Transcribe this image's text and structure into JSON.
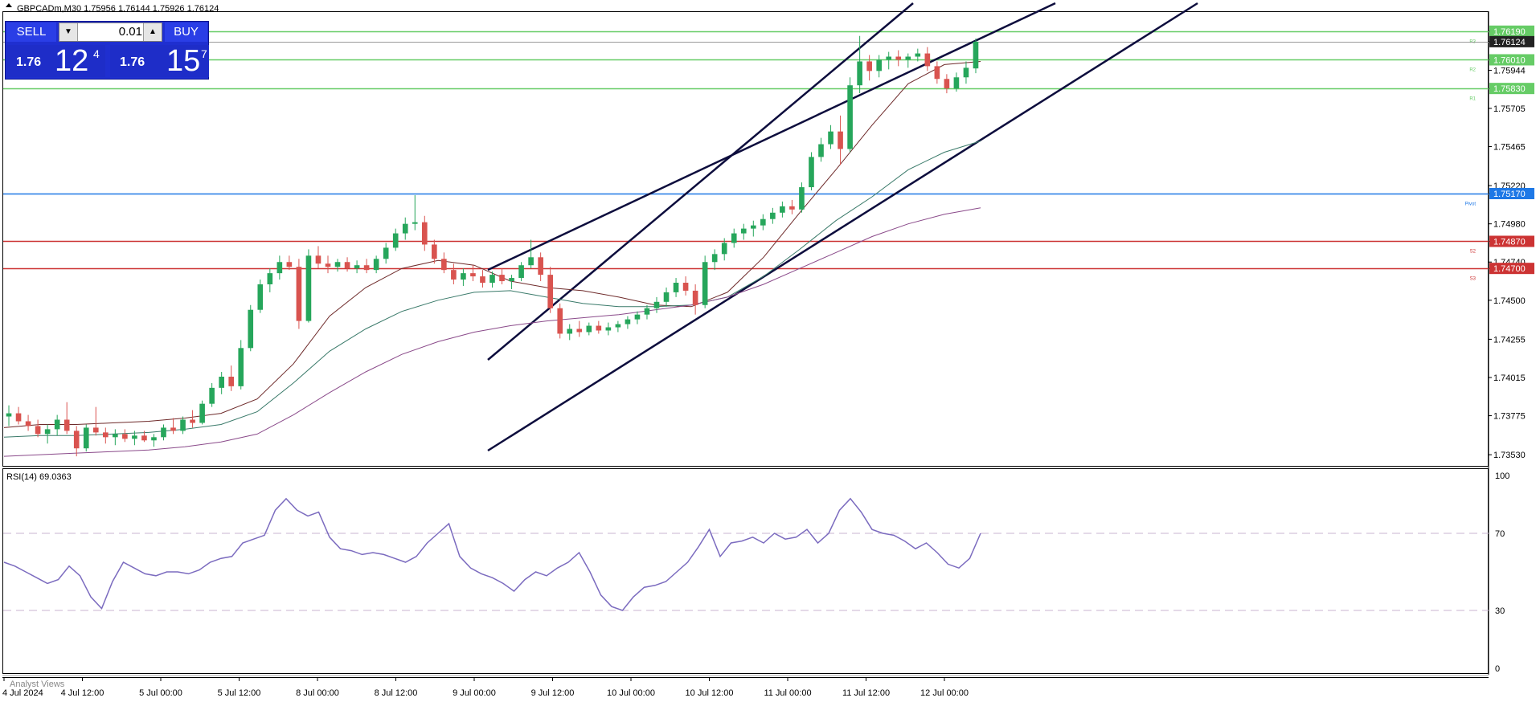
{
  "header": {
    "symbol_ohlc": "GBPCADm,M30  1.75956 1.76144 1.75926 1.76124",
    "rsi_label": "RSI(14) 69.0363",
    "analyst_views": "Analyst Views"
  },
  "trade_panel": {
    "sell_label": "SELL",
    "buy_label": "BUY",
    "lot": "0.01",
    "sell_prefix": "1.76",
    "sell_big": "12",
    "sell_sup": "4",
    "buy_prefix": "1.76",
    "buy_big": "15",
    "buy_sup": "7"
  },
  "chart_data": {
    "type": "candlestick",
    "symbol": "GBPCADm",
    "timeframe": "M30",
    "price_ticks": [
      1.7619,
      1.76124,
      1.7601,
      1.75944,
      1.7583,
      1.75705,
      1.75465,
      1.7522,
      1.7517,
      1.7498,
      1.7487,
      1.7474,
      1.747,
      1.745,
      1.74255,
      1.74015,
      1.73775,
      1.7353
    ],
    "price_tick_labels": [
      "1.76190",
      "1.76124",
      "1.76010",
      "1.75944",
      "1.75830",
      "1.75705",
      "1.75465",
      "1.75220",
      "1.75170",
      "1.74980",
      "1.74870",
      "1.74740",
      "1.74700",
      "1.74500",
      "1.74255",
      "1.74015",
      "1.73775",
      "1.73530"
    ],
    "ylim": [
      1.7346,
      1.7631
    ],
    "x_labels": [
      "4 Jul 2024",
      "4 Jul 12:00",
      "5 Jul 00:00",
      "5 Jul 12:00",
      "8 Jul 00:00",
      "8 Jul 12:00",
      "9 Jul 00:00",
      "9 Jul 12:00",
      "10 Jul 00:00",
      "10 Jul 12:00",
      "11 Jul 00:00",
      "11 Jul 12:00",
      "12 Jul 00:00"
    ],
    "current_price": 1.76124,
    "levels": [
      {
        "price": 1.7619,
        "label": "1.76190",
        "tag": "R3",
        "color": "#66cc66"
      },
      {
        "price": 1.7601,
        "label": "1.76010",
        "tag": "R2",
        "color": "#66cc66"
      },
      {
        "price": 1.7583,
        "label": "1.75830",
        "tag": "R1",
        "color": "#66cc66"
      },
      {
        "price": 1.7517,
        "label": "1.75170",
        "tag": "Pivot",
        "color": "#1e78e6"
      },
      {
        "price": 1.7487,
        "label": "1.74870",
        "tag": "S2",
        "color": "#cc3333"
      },
      {
        "price": 1.747,
        "label": "1.74700",
        "tag": "S3",
        "color": "#cc3333"
      }
    ],
    "candles": [
      {
        "o": 1.7377,
        "h": 1.7384,
        "l": 1.7371,
        "c": 1.7379
      },
      {
        "o": 1.7379,
        "h": 1.7383,
        "l": 1.7372,
        "c": 1.7374
      },
      {
        "o": 1.7374,
        "h": 1.7378,
        "l": 1.7368,
        "c": 1.7371
      },
      {
        "o": 1.7371,
        "h": 1.7375,
        "l": 1.7364,
        "c": 1.7366
      },
      {
        "o": 1.7366,
        "h": 1.7372,
        "l": 1.736,
        "c": 1.7369
      },
      {
        "o": 1.7369,
        "h": 1.7378,
        "l": 1.7365,
        "c": 1.7375
      },
      {
        "o": 1.7375,
        "h": 1.7386,
        "l": 1.7366,
        "c": 1.7368
      },
      {
        "o": 1.7368,
        "h": 1.7371,
        "l": 1.7352,
        "c": 1.7357
      },
      {
        "o": 1.7357,
        "h": 1.7372,
        "l": 1.7355,
        "c": 1.737
      },
      {
        "o": 1.737,
        "h": 1.7383,
        "l": 1.7365,
        "c": 1.7367
      },
      {
        "o": 1.7367,
        "h": 1.737,
        "l": 1.736,
        "c": 1.7364
      },
      {
        "o": 1.7364,
        "h": 1.7369,
        "l": 1.7359,
        "c": 1.7366
      },
      {
        "o": 1.7366,
        "h": 1.7369,
        "l": 1.7361,
        "c": 1.7363
      },
      {
        "o": 1.7363,
        "h": 1.7368,
        "l": 1.7359,
        "c": 1.7365
      },
      {
        "o": 1.7365,
        "h": 1.7368,
        "l": 1.7361,
        "c": 1.7362
      },
      {
        "o": 1.7362,
        "h": 1.7366,
        "l": 1.7358,
        "c": 1.7364
      },
      {
        "o": 1.7364,
        "h": 1.7372,
        "l": 1.7362,
        "c": 1.737
      },
      {
        "o": 1.737,
        "h": 1.7376,
        "l": 1.7366,
        "c": 1.7368
      },
      {
        "o": 1.7368,
        "h": 1.7377,
        "l": 1.7366,
        "c": 1.7375
      },
      {
        "o": 1.7375,
        "h": 1.7381,
        "l": 1.737,
        "c": 1.7373
      },
      {
        "o": 1.7373,
        "h": 1.7387,
        "l": 1.7372,
        "c": 1.7385
      },
      {
        "o": 1.7385,
        "h": 1.7398,
        "l": 1.7383,
        "c": 1.7395
      },
      {
        "o": 1.7395,
        "h": 1.7405,
        "l": 1.7391,
        "c": 1.7402
      },
      {
        "o": 1.7402,
        "h": 1.7409,
        "l": 1.7393,
        "c": 1.7396
      },
      {
        "o": 1.7396,
        "h": 1.7425,
        "l": 1.7394,
        "c": 1.742
      },
      {
        "o": 1.742,
        "h": 1.7447,
        "l": 1.7418,
        "c": 1.7444
      },
      {
        "o": 1.7444,
        "h": 1.7463,
        "l": 1.7442,
        "c": 1.746
      },
      {
        "o": 1.746,
        "h": 1.747,
        "l": 1.7455,
        "c": 1.7467
      },
      {
        "o": 1.7467,
        "h": 1.7478,
        "l": 1.7463,
        "c": 1.7474
      },
      {
        "o": 1.7474,
        "h": 1.7478,
        "l": 1.7469,
        "c": 1.7471
      },
      {
        "o": 1.7471,
        "h": 1.7476,
        "l": 1.7432,
        "c": 1.7437
      },
      {
        "o": 1.7437,
        "h": 1.7482,
        "l": 1.7436,
        "c": 1.7478
      },
      {
        "o": 1.7478,
        "h": 1.7484,
        "l": 1.747,
        "c": 1.7473
      },
      {
        "o": 1.7473,
        "h": 1.7478,
        "l": 1.7467,
        "c": 1.7471
      },
      {
        "o": 1.7471,
        "h": 1.7476,
        "l": 1.7468,
        "c": 1.7474
      },
      {
        "o": 1.7474,
        "h": 1.7477,
        "l": 1.7468,
        "c": 1.747
      },
      {
        "o": 1.747,
        "h": 1.7475,
        "l": 1.7467,
        "c": 1.7472
      },
      {
        "o": 1.7472,
        "h": 1.7476,
        "l": 1.7467,
        "c": 1.7469
      },
      {
        "o": 1.7469,
        "h": 1.7478,
        "l": 1.7467,
        "c": 1.7476
      },
      {
        "o": 1.7476,
        "h": 1.7486,
        "l": 1.7473,
        "c": 1.7483
      },
      {
        "o": 1.7483,
        "h": 1.7495,
        "l": 1.7481,
        "c": 1.7492
      },
      {
        "o": 1.7492,
        "h": 1.7502,
        "l": 1.7488,
        "c": 1.7498
      },
      {
        "o": 1.7498,
        "h": 1.7516,
        "l": 1.7494,
        "c": 1.7499
      },
      {
        "o": 1.7499,
        "h": 1.7503,
        "l": 1.7481,
        "c": 1.7485
      },
      {
        "o": 1.7485,
        "h": 1.7488,
        "l": 1.7473,
        "c": 1.7476
      },
      {
        "o": 1.7476,
        "h": 1.748,
        "l": 1.7467,
        "c": 1.7469
      },
      {
        "o": 1.7469,
        "h": 1.7473,
        "l": 1.746,
        "c": 1.7463
      },
      {
        "o": 1.7463,
        "h": 1.747,
        "l": 1.7459,
        "c": 1.7467
      },
      {
        "o": 1.7467,
        "h": 1.7472,
        "l": 1.7462,
        "c": 1.7465
      },
      {
        "o": 1.7465,
        "h": 1.7469,
        "l": 1.7458,
        "c": 1.7461
      },
      {
        "o": 1.7461,
        "h": 1.7468,
        "l": 1.7458,
        "c": 1.7466
      },
      {
        "o": 1.7466,
        "h": 1.747,
        "l": 1.746,
        "c": 1.7462
      },
      {
        "o": 1.7462,
        "h": 1.7466,
        "l": 1.7457,
        "c": 1.7464
      },
      {
        "o": 1.7464,
        "h": 1.7474,
        "l": 1.7462,
        "c": 1.7472
      },
      {
        "o": 1.7472,
        "h": 1.7488,
        "l": 1.747,
        "c": 1.7477
      },
      {
        "o": 1.7477,
        "h": 1.748,
        "l": 1.7462,
        "c": 1.7466
      },
      {
        "o": 1.7466,
        "h": 1.7471,
        "l": 1.7442,
        "c": 1.7445
      },
      {
        "o": 1.7445,
        "h": 1.7448,
        "l": 1.7426,
        "c": 1.7429
      },
      {
        "o": 1.7429,
        "h": 1.7435,
        "l": 1.7425,
        "c": 1.7432
      },
      {
        "o": 1.7432,
        "h": 1.7437,
        "l": 1.7427,
        "c": 1.743
      },
      {
        "o": 1.743,
        "h": 1.7436,
        "l": 1.7428,
        "c": 1.7434
      },
      {
        "o": 1.7434,
        "h": 1.7437,
        "l": 1.7429,
        "c": 1.7431
      },
      {
        "o": 1.7431,
        "h": 1.7436,
        "l": 1.7428,
        "c": 1.7433
      },
      {
        "o": 1.7433,
        "h": 1.7437,
        "l": 1.743,
        "c": 1.7435
      },
      {
        "o": 1.7435,
        "h": 1.744,
        "l": 1.7432,
        "c": 1.7438
      },
      {
        "o": 1.7438,
        "h": 1.7443,
        "l": 1.7435,
        "c": 1.7441
      },
      {
        "o": 1.7441,
        "h": 1.7447,
        "l": 1.7438,
        "c": 1.7445
      },
      {
        "o": 1.7445,
        "h": 1.7452,
        "l": 1.7442,
        "c": 1.7449
      },
      {
        "o": 1.7449,
        "h": 1.7458,
        "l": 1.7446,
        "c": 1.7455
      },
      {
        "o": 1.7455,
        "h": 1.7464,
        "l": 1.7452,
        "c": 1.7461
      },
      {
        "o": 1.7461,
        "h": 1.7465,
        "l": 1.7453,
        "c": 1.7456
      },
      {
        "o": 1.7456,
        "h": 1.746,
        "l": 1.7441,
        "c": 1.7447
      },
      {
        "o": 1.7447,
        "h": 1.7478,
        "l": 1.7445,
        "c": 1.7474
      },
      {
        "o": 1.7474,
        "h": 1.7482,
        "l": 1.7469,
        "c": 1.7479
      },
      {
        "o": 1.7479,
        "h": 1.7489,
        "l": 1.7475,
        "c": 1.7486
      },
      {
        "o": 1.7486,
        "h": 1.7495,
        "l": 1.7483,
        "c": 1.7492
      },
      {
        "o": 1.7492,
        "h": 1.7498,
        "l": 1.7488,
        "c": 1.7495
      },
      {
        "o": 1.7495,
        "h": 1.75,
        "l": 1.749,
        "c": 1.7497
      },
      {
        "o": 1.7497,
        "h": 1.7504,
        "l": 1.7494,
        "c": 1.7501
      },
      {
        "o": 1.7501,
        "h": 1.7508,
        "l": 1.7498,
        "c": 1.7505
      },
      {
        "o": 1.7505,
        "h": 1.7512,
        "l": 1.7502,
        "c": 1.7509
      },
      {
        "o": 1.7509,
        "h": 1.7513,
        "l": 1.7504,
        "c": 1.7507
      },
      {
        "o": 1.7507,
        "h": 1.7524,
        "l": 1.7505,
        "c": 1.7521
      },
      {
        "o": 1.7521,
        "h": 1.7543,
        "l": 1.7519,
        "c": 1.754
      },
      {
        "o": 1.754,
        "h": 1.7552,
        "l": 1.7537,
        "c": 1.7548
      },
      {
        "o": 1.7548,
        "h": 1.756,
        "l": 1.7545,
        "c": 1.7556
      },
      {
        "o": 1.7556,
        "h": 1.7566,
        "l": 1.7535,
        "c": 1.7545
      },
      {
        "o": 1.7545,
        "h": 1.759,
        "l": 1.7543,
        "c": 1.7585
      },
      {
        "o": 1.7585,
        "h": 1.7616,
        "l": 1.758,
        "c": 1.76
      },
      {
        "o": 1.76,
        "h": 1.7604,
        "l": 1.7588,
        "c": 1.7594
      },
      {
        "o": 1.7594,
        "h": 1.7604,
        "l": 1.759,
        "c": 1.7601
      },
      {
        "o": 1.7601,
        "h": 1.7606,
        "l": 1.7595,
        "c": 1.7603
      },
      {
        "o": 1.7603,
        "h": 1.7607,
        "l": 1.7597,
        "c": 1.7601
      },
      {
        "o": 1.7601,
        "h": 1.7605,
        "l": 1.7596,
        "c": 1.7603
      },
      {
        "o": 1.7603,
        "h": 1.7608,
        "l": 1.76,
        "c": 1.7605
      },
      {
        "o": 1.7605,
        "h": 1.7609,
        "l": 1.7594,
        "c": 1.7597
      },
      {
        "o": 1.7597,
        "h": 1.76,
        "l": 1.7586,
        "c": 1.7589
      },
      {
        "o": 1.7589,
        "h": 1.7592,
        "l": 1.758,
        "c": 1.7583
      },
      {
        "o": 1.7583,
        "h": 1.7593,
        "l": 1.7581,
        "c": 1.759
      },
      {
        "o": 1.759,
        "h": 1.76,
        "l": 1.7586,
        "c": 1.7596
      },
      {
        "o": 1.75956,
        "h": 1.76144,
        "l": 1.75926,
        "c": 1.76124
      }
    ],
    "ma_series": [
      {
        "color": "#6e2a2a",
        "values": [
          1.737,
          1.7372,
          1.7372,
          1.7373,
          1.7374,
          1.7376,
          1.7379,
          1.7388,
          1.741,
          1.744,
          1.7458,
          1.747,
          1.7475,
          1.7472,
          1.7462,
          1.7458,
          1.7456,
          1.7452,
          1.7447,
          1.7446,
          1.7455,
          1.7477,
          1.7505,
          1.7532,
          1.756,
          1.7586,
          1.7598,
          1.76
        ]
      },
      {
        "color": "#3a7a6a",
        "values": [
          1.7364,
          1.7365,
          1.7365,
          1.7366,
          1.7367,
          1.7369,
          1.7372,
          1.738,
          1.7398,
          1.7418,
          1.7432,
          1.7443,
          1.745,
          1.7455,
          1.7456,
          1.7452,
          1.7448,
          1.7446,
          1.7446,
          1.7447,
          1.7452,
          1.7465,
          1.7482,
          1.75,
          1.7515,
          1.7532,
          1.7543,
          1.755
        ]
      },
      {
        "color": "#8a4a8a",
        "values": [
          1.7352,
          1.7353,
          1.7354,
          1.7355,
          1.7356,
          1.7358,
          1.7361,
          1.7366,
          1.7378,
          1.7392,
          1.7405,
          1.7416,
          1.7424,
          1.743,
          1.7434,
          1.7437,
          1.7439,
          1.7441,
          1.7444,
          1.7447,
          1.7452,
          1.746,
          1.747,
          1.748,
          1.749,
          1.7498,
          1.7504,
          1.7508
        ]
      }
    ],
    "rsi": {
      "period": 14,
      "last": 69.0363,
      "levels": [
        70,
        30
      ],
      "ticks": [
        "100",
        "70",
        "30",
        "0"
      ],
      "values": [
        55,
        53,
        50,
        47,
        44,
        46,
        53,
        48,
        37,
        31,
        45,
        55,
        52,
        49,
        48,
        50,
        50,
        49,
        51,
        55,
        57,
        58,
        65,
        67,
        69,
        82,
        88,
        82,
        79,
        81,
        68,
        62,
        61,
        59,
        60,
        59,
        57,
        55,
        58,
        65,
        70,
        75,
        58,
        52,
        49,
        47,
        44,
        40,
        46,
        50,
        48,
        52,
        55,
        60,
        50,
        38,
        32,
        30,
        37,
        42,
        43,
        45,
        50,
        55,
        63,
        72,
        58,
        65,
        66,
        68,
        65,
        70,
        67,
        68,
        72,
        65,
        70,
        82,
        88,
        81,
        72,
        70,
        69,
        66,
        62,
        65,
        60,
        54,
        52,
        57,
        70
      ]
    }
  }
}
